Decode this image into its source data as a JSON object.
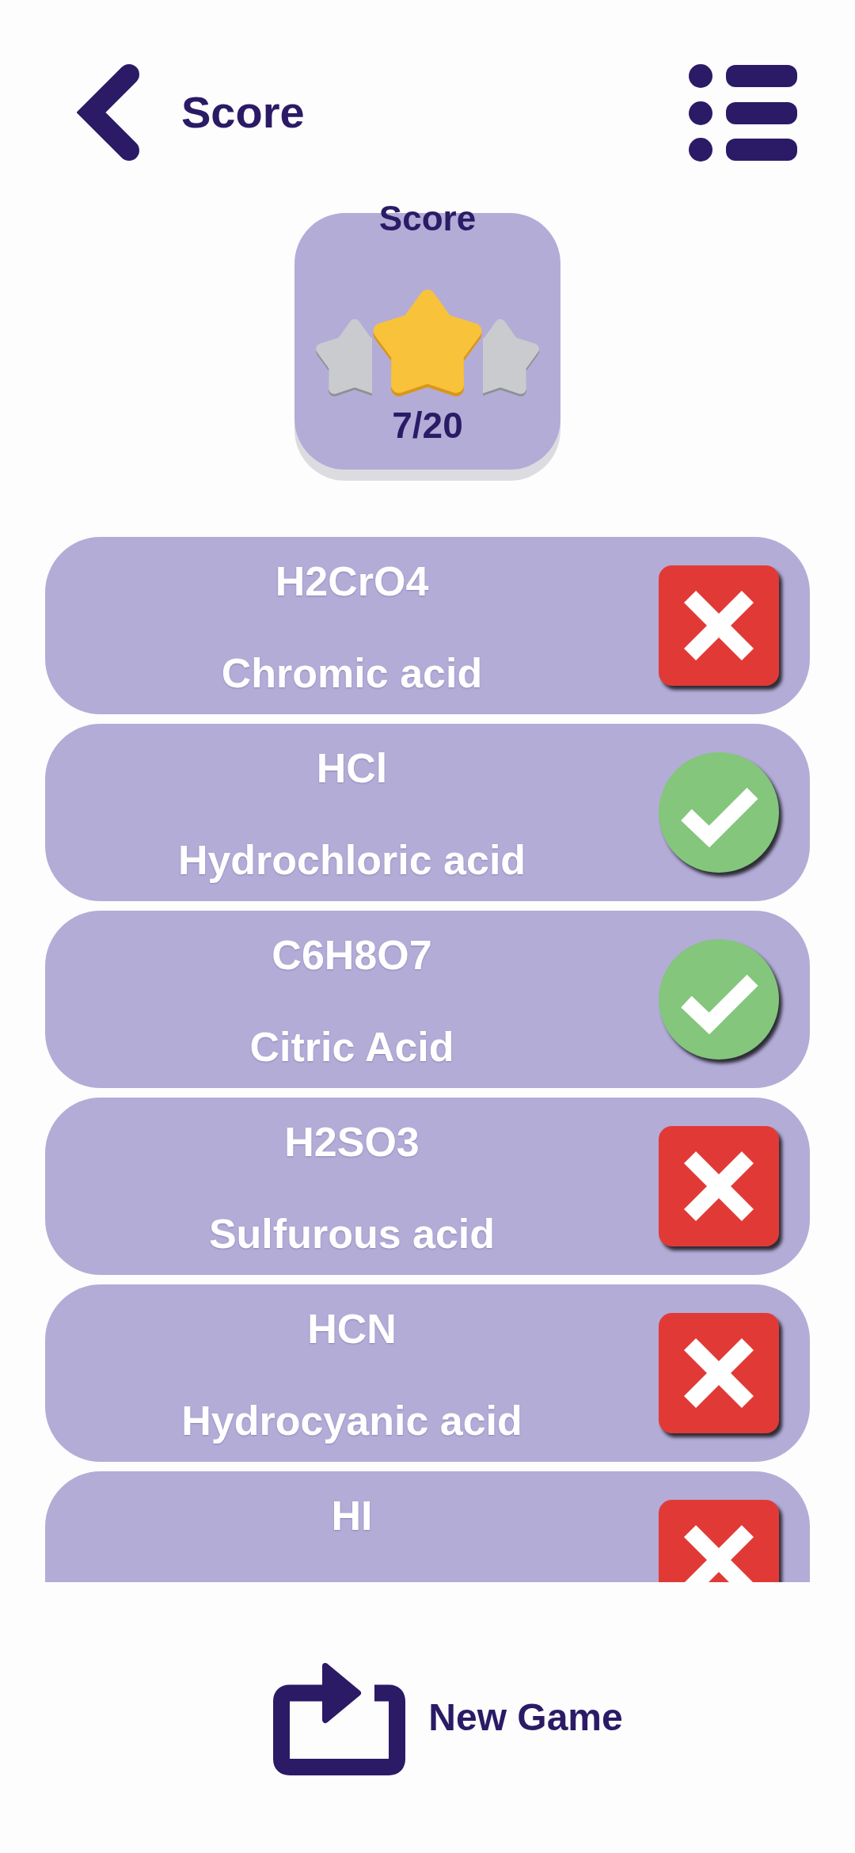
{
  "header": {
    "title": "Score"
  },
  "score": {
    "title": "Score",
    "stars": 1,
    "value": "7/20"
  },
  "results": [
    {
      "formula": "H2CrO4",
      "name": "Chromic acid",
      "correct": false
    },
    {
      "formula": "HCl",
      "name": "Hydrochloric acid",
      "correct": true
    },
    {
      "formula": "C6H8O7",
      "name": "Citric Acid",
      "correct": true
    },
    {
      "formula": "H2SO3",
      "name": "Sulfurous acid",
      "correct": false
    },
    {
      "formula": "HCN",
      "name": "Hydrocyanic acid",
      "correct": false
    },
    {
      "formula": "HI",
      "correct": false
    }
  ],
  "new_game": {
    "label": "New Game"
  }
}
